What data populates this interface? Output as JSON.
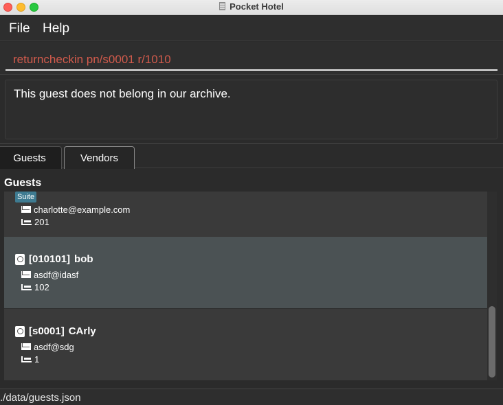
{
  "window": {
    "title": "Pocket Hotel"
  },
  "menu": {
    "file_label": "File",
    "help_label": "Help"
  },
  "command": {
    "value": "returncheckin pn/s0001 r/1010"
  },
  "result": {
    "message": "This guest does not belong in our archive."
  },
  "tabs": [
    {
      "label": "Guests",
      "selected": true
    },
    {
      "label": "Vendors",
      "selected": false
    }
  ],
  "guest_panel": {
    "title": "Guests",
    "cards": [
      {
        "tag": "Suite",
        "email": "charlotte@example.com",
        "room": "201"
      },
      {
        "id": "[010101]",
        "name": "bob",
        "email": "asdf@idasf",
        "room": "102",
        "highlighted": true
      },
      {
        "id": "[s0001]",
        "name": "CArly",
        "email": "asdf@sdg",
        "room": "1"
      }
    ]
  },
  "status": {
    "path": "./data/guests.json"
  },
  "icons": {
    "traffic": [
      "close-icon",
      "minimize-icon",
      "maximize-icon"
    ],
    "card": [
      "passport-icon",
      "mail-icon",
      "bed-icon"
    ]
  },
  "colors": {
    "background": "#2b2b2b",
    "command_text": "#d35b4c",
    "tag": "#3e7b91",
    "selected_card": "#4b5254"
  }
}
